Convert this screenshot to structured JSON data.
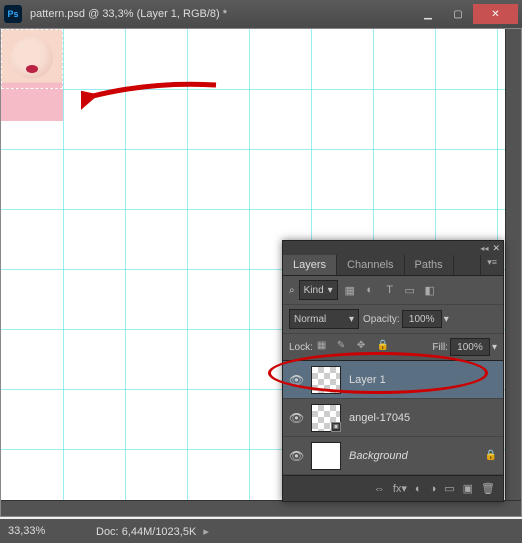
{
  "titlebar": {
    "app_icon_text": "Ps",
    "title": "pattern.psd @ 33,3% (Layer 1, RGB/8) *"
  },
  "annotation": {
    "arrow_color": "#c00"
  },
  "status": {
    "zoom": "33,33%",
    "doc_label": "Doc:",
    "doc_value": "6,44M/1023,5K"
  },
  "panel": {
    "tabs": [
      "Layers",
      "Channels",
      "Paths"
    ],
    "active_tab": 0,
    "filter": {
      "search_icon": "⌕",
      "kind_label": "Kind",
      "kind_dropdown_caret": "▾",
      "icons": [
        "▦",
        "◐",
        "T",
        "▭",
        "◧"
      ]
    },
    "blend": {
      "mode": "Normal",
      "opacity_label": "Opacity:",
      "opacity_value": "100%"
    },
    "lock": {
      "label": "Lock:",
      "icons": [
        "▦",
        "✎",
        "✥",
        "🔒"
      ],
      "fill_label": "Fill:",
      "fill_value": "100%"
    },
    "layers": [
      {
        "name": "Layer 1",
        "active": true,
        "thumb": "checker",
        "italic": false,
        "smartobj": false
      },
      {
        "name": "angel-17045",
        "active": false,
        "thumb": "checker",
        "italic": false,
        "smartobj": true
      },
      {
        "name": "Background",
        "active": false,
        "thumb": "white",
        "italic": true,
        "smartobj": false
      }
    ],
    "footer_icons": [
      "⇔",
      "fx▾",
      "◐",
      "◑",
      "▭",
      "▣",
      "🗑"
    ]
  }
}
